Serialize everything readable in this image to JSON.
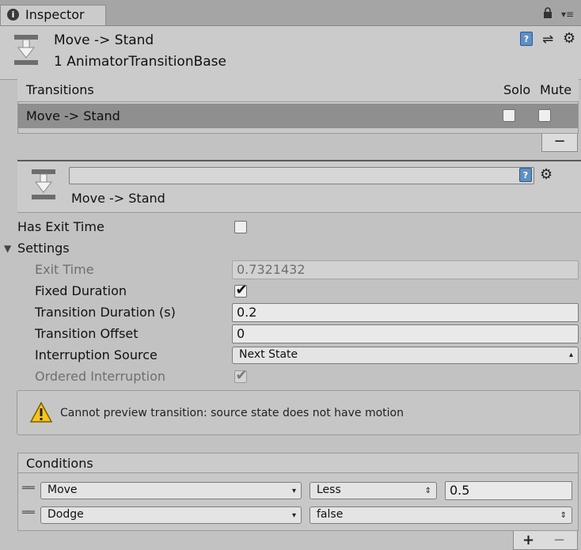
{
  "window": {
    "tab_title": "Inspector"
  },
  "header": {
    "title": "Move -> Stand",
    "subtitle": "1 AnimatorTransitionBase"
  },
  "transitions": {
    "header": "Transitions",
    "col_solo": "Solo",
    "col_mute": "Mute",
    "rows": [
      {
        "name": "Move -> Stand",
        "solo": false,
        "mute": false
      }
    ],
    "remove_label": "−"
  },
  "transition": {
    "name_value": "",
    "display_name": "Move -> Stand"
  },
  "fields": {
    "has_exit_time": {
      "label": "Has Exit Time",
      "checked": false
    },
    "settings": {
      "label": "Settings",
      "expanded": true
    },
    "exit_time": {
      "label": "Exit Time",
      "value": "0.7321432"
    },
    "fixed_duration": {
      "label": "Fixed Duration",
      "checked": true
    },
    "transition_duration": {
      "label": "Transition Duration (s)",
      "value": "0.2"
    },
    "transition_offset": {
      "label": "Transition Offset",
      "value": "0"
    },
    "interruption_source": {
      "label": "Interruption Source",
      "value": "Next State"
    },
    "ordered_interruption": {
      "label": "Ordered Interruption",
      "checked": true
    }
  },
  "warning": {
    "message": "Cannot preview transition: source state does not have motion"
  },
  "conditions": {
    "header": "Conditions",
    "rows": [
      {
        "parameter": "Move",
        "mode": "Less",
        "value": "0.5"
      },
      {
        "parameter": "Dodge",
        "value": "false"
      }
    ],
    "add_label": "+",
    "remove_label": "−"
  }
}
